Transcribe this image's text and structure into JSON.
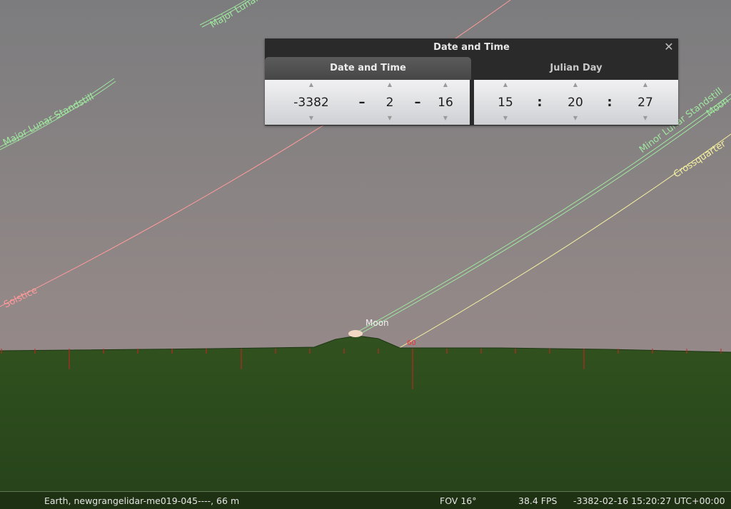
{
  "sky": {
    "labels": {
      "major_lunar_top": "Major Lunar Standstill",
      "major_lunar_left": "Major Lunar Standstill",
      "solstice": "Solstice",
      "minor_lunar": "Minor Lunar Standstill",
      "moon_line": "Moon",
      "crossquarter": "Crossquarter"
    },
    "moon_label": "Moon",
    "azimuth_label": "60"
  },
  "dialog": {
    "title": "Date and Time",
    "tabs": [
      "Date and Time",
      "Julian Day"
    ],
    "date": {
      "year": "-3382",
      "sep1": "–",
      "month": "2",
      "sep2": "–",
      "day": "16"
    },
    "time": {
      "hour": "15",
      "sep1": ":",
      "minute": "20",
      "sep2": ":",
      "second": "27"
    }
  },
  "status": {
    "location": "Earth, newgrangelidar-me019-045----, 66 m",
    "fov": "FOV 16°",
    "fps": "38.4 FPS",
    "datetime": "-3382-02-16 15:20:27 UTC+00:00"
  },
  "colors": {
    "lunar_line": "#9fe89f",
    "solstice_line": "#ff9a9a",
    "crossquarter_line": "#f5f0a0",
    "azimuth_marker": "#cc2222",
    "ground": "#2d4a1f"
  }
}
